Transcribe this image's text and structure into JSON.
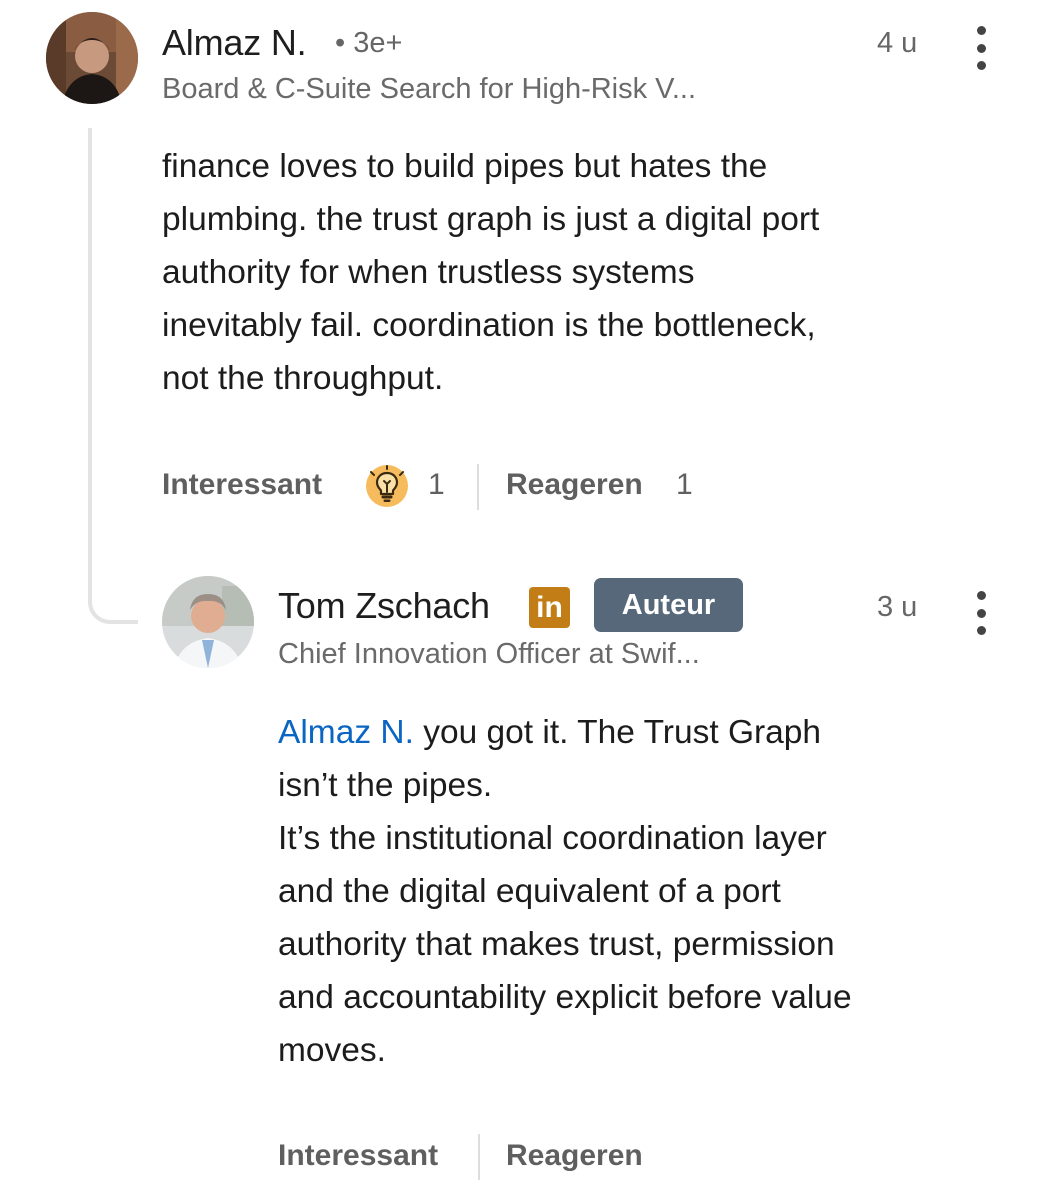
{
  "comment": {
    "author": "Almaz N.",
    "degree": "• 3e+",
    "headline": "Board & C-Suite Search for High-Risk V...",
    "time": "4 u",
    "text": "finance loves to build pipes but hates the\nplumbing. the trust graph is just a digital port\nauthority for when trustless systems\ninevitably fail. coordination is the bottleneck,\nnot the throughput.",
    "actions": {
      "like_label": "Interessant",
      "reaction_icon": "lightbulb-icon",
      "reaction_count": "1",
      "reply_label": "Reageren",
      "reply_count": "1"
    }
  },
  "reply": {
    "author": "Tom Zschach",
    "badge_icon": "linkedin-icon",
    "badge_text": "in",
    "author_badge": "Auteur",
    "headline": "Chief Innovation Officer at Swif...",
    "time": "3 u",
    "mention": "Almaz N.",
    "text": " you got it. The Trust Graph\nisn’t the pipes.\nIt’s the institutional coordination layer\nand the digital equivalent of a port\nauthority that makes trust, permission\nand accountability explicit before value\nmoves.",
    "actions": {
      "like_label": "Interessant",
      "reply_label": "Reageren"
    }
  },
  "colors": {
    "mention": "#0a66c2",
    "badge_bg": "#56687a",
    "linkedin_badge": "#c37d16",
    "reaction_icon": "#f5bb5c"
  }
}
